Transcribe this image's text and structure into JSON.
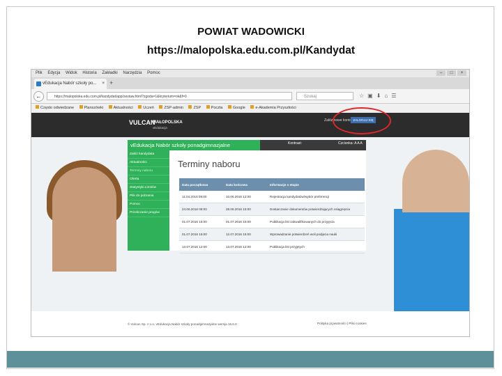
{
  "slide": {
    "title": "POWIAT WADOWICKI",
    "url": "https://malopolska.edu.com.pl/Kandydat"
  },
  "browser": {
    "menu": [
      "Plik",
      "Edycja",
      "Widok",
      "Historia",
      "Zakładki",
      "Narzędzia",
      "Pomoc"
    ],
    "tab_title": "vEdukacja Nabór szkoły po...",
    "tab_close": "×",
    "tab_new": "+",
    "address": "https://malopolska.edu.com.pl/kandydat/app/zestaw.html?zgoda=1&kryterium=ok&f=0",
    "search_placeholder": "Szukaj",
    "bookmarks": [
      "Często odwiedzane",
      "Planszówki",
      "Aktualności",
      "Uczeń",
      "ZSP-admin",
      "ZSP",
      "Poczta",
      "Google",
      "e-Akademia Przyszłości"
    ]
  },
  "site": {
    "logo": "VULCAN",
    "region": "MAŁOPOLSKA",
    "region_sub": "vEdukacja",
    "new_account": "Załóż nowe konto",
    "login": "ZALOGUJ SIĘ",
    "panel_title": "vEdukacja Nabór szkoły ponadgimnazjalne",
    "contrast_label": "Kontrast:",
    "font_label": "Czcionka:",
    "font_sizes": "A A A",
    "sidebar": [
      "Załóż kandydata",
      "Aktualności",
      "Terminy naboru",
      "Oferta",
      "Statystyki Limitów",
      "Plik do pobrania",
      "Pomoc",
      "Przeliczanie progów"
    ],
    "page_title": "Terminy naboru",
    "table": {
      "headers": [
        "Data początkowa",
        "Data końcowa",
        "Informacje o etapie"
      ],
      "rows": [
        [
          "11.04.2016 08:00",
          "10.06.2016 12:00",
          "Rejestracja kandydatów/wybór preferencji"
        ],
        [
          "24.06.2016 08:00",
          "28.06.2016 15:00",
          "Dostarczanie dokumentów potwierdzających osiągnięcia"
        ],
        [
          "01.07.2016 15:00",
          "01.07.2016 15:00",
          "Publikacja list zakwalifikowanych do przyjęcia"
        ],
        [
          "01.07.2016 15:00",
          "12.07.2016 15:00",
          "Wprowadzanie potwierdzeń woli podjęcia nauki"
        ],
        [
          "13.07.2016 12:00",
          "13.07.2016 12:00",
          "Publikacja list przyjętych"
        ]
      ]
    },
    "footer_left": "© Vulcan Sp. z o.o. vEdukacja Nabór szkoły ponadgimnazjalne wersja 16.6.0",
    "footer_right": "Polityka prywatności | Pliki cookies"
  }
}
